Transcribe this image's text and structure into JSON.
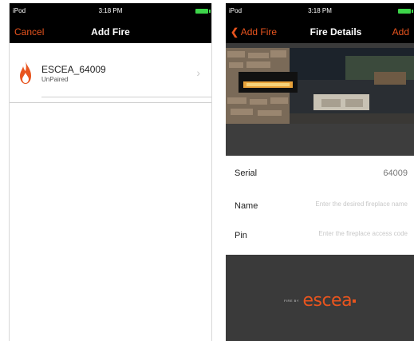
{
  "left_screen": {
    "status_bar": {
      "carrier": "iPod",
      "time": "3:18 PM"
    },
    "nav": {
      "cancel_label": "Cancel",
      "title": "Add Fire"
    },
    "fires": [
      {
        "name": "ESCEA_64009",
        "status": "UnPaired",
        "icon": "flame-icon"
      }
    ]
  },
  "right_screen": {
    "status_bar": {
      "carrier": "iPod",
      "time": "3:18 PM"
    },
    "nav": {
      "back_label": "Add Fire",
      "title": "Fire Details",
      "add_label": "Add"
    },
    "fields": {
      "serial": {
        "label": "Serial",
        "value": "64009"
      },
      "name": {
        "label": "Name",
        "placeholder": "Enter the desired fireplace name"
      },
      "pin": {
        "label": "Pin",
        "placeholder": "Enter the fireplace access code"
      }
    },
    "logo": {
      "prefix": "FIRE BY",
      "brand": "escea"
    }
  },
  "colors": {
    "accent": "#e8541e",
    "battery": "#3dd54a",
    "nav_bg": "#000000"
  }
}
